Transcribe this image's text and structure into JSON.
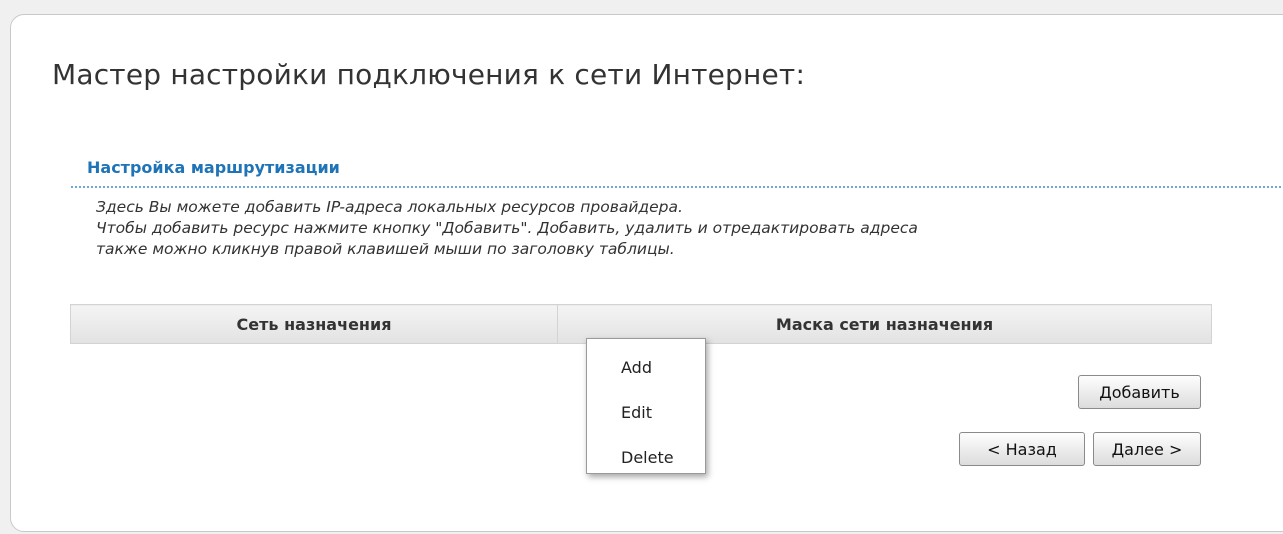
{
  "wizard": {
    "title": "Мастер настройки подключения к сети Интернет:"
  },
  "routing": {
    "section_title": "Настройка маршрутизации",
    "description_lines": [
      "Здесь Вы можете добавить IP-адреса локальных ресурсов провайдера.",
      "Чтобы добавить ресурс нажмите кнопку \"Добавить\". Добавить, удалить и отредактировать адреса",
      "также можно кликнув правой клавишей мыши по заголовку таблицы."
    ],
    "table": {
      "columns": [
        "Сеть назначения",
        "Маска сети назначения"
      ],
      "rows": []
    }
  },
  "context_menu": {
    "items": [
      "Add",
      "Edit",
      "Delete"
    ]
  },
  "buttons": {
    "add_label": "Добавить",
    "back_label": "< Назад",
    "next_label": "Далее >"
  },
  "colors": {
    "section_title": "#1f73b7",
    "divider": "#6fa9d3"
  }
}
